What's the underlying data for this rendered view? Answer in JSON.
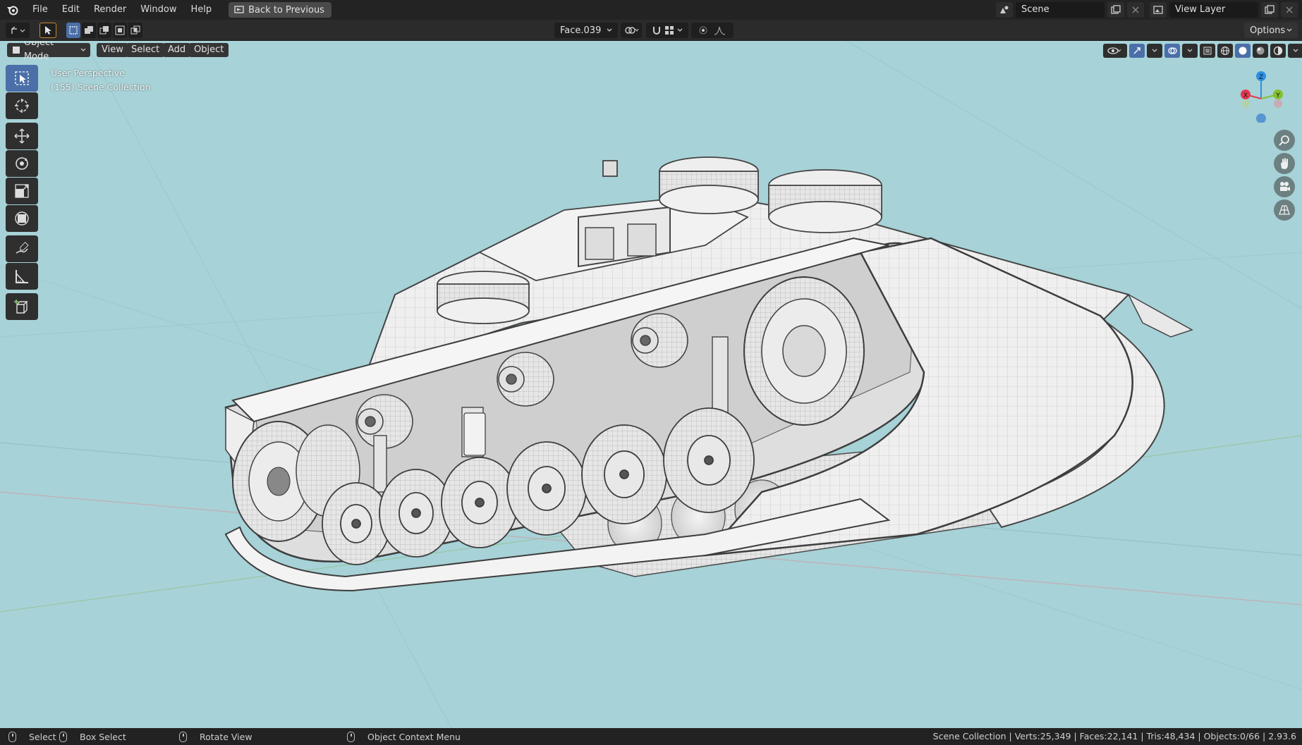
{
  "menubar": {
    "items": [
      "File",
      "Edit",
      "Render",
      "Window",
      "Help"
    ],
    "back_button": "Back to Previous",
    "scene": "Scene",
    "view_layer": "View Layer"
  },
  "toolheader": {
    "active_face": "Face.039",
    "options": "Options"
  },
  "viewport_header": {
    "mode": "Object Mode",
    "menus": [
      "View",
      "Select",
      "Add",
      "Object"
    ]
  },
  "overlay": {
    "line1": "User Perspective",
    "line2": "(155) Scene Collection"
  },
  "gizmo": {
    "x": "X",
    "y": "Y",
    "z": "Z"
  },
  "tools": [
    "select-box",
    "cursor",
    "move",
    "rotate",
    "scale",
    "transform",
    "annotate",
    "measure",
    "add-cube"
  ],
  "statusbar": {
    "select": "Select",
    "box_select": "Box Select",
    "rotate_view": "Rotate View",
    "context_menu": "Object Context Menu",
    "stats": "Scene Collection | Verts:25,349 | Faces:22,141 | Tris:48,434 | Objects:0/66 | 2.93.6"
  },
  "colors": {
    "viewport_bg": "#a7d2d7",
    "accent": "#4b6fa8",
    "axis_x": "#e5374f",
    "axis_y": "#83c02b",
    "axis_z": "#2e8fe3"
  }
}
